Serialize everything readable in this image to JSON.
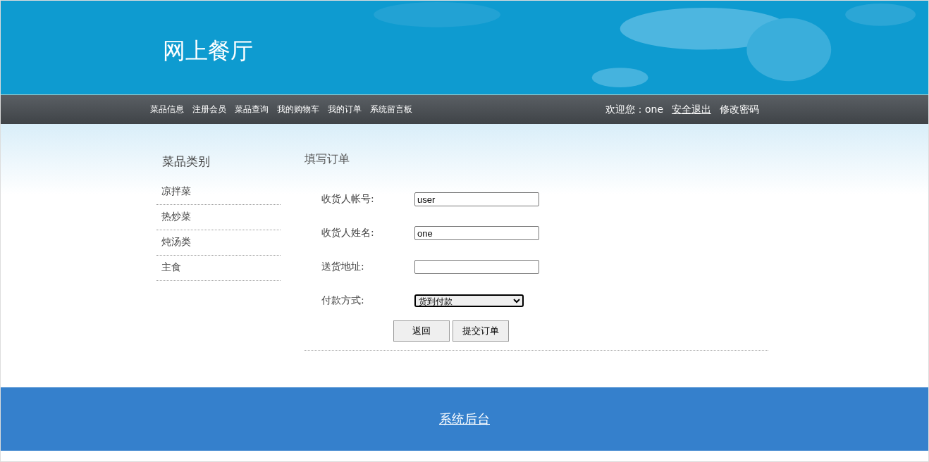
{
  "header": {
    "title": "网上餐厅"
  },
  "nav": {
    "items": [
      {
        "label": "菜品信息"
      },
      {
        "label": "注册会员"
      },
      {
        "label": "菜品查询"
      },
      {
        "label": "我的购物车"
      },
      {
        "label": "我的订单"
      },
      {
        "label": "系统留言板"
      }
    ],
    "welcome": "欢迎您：one",
    "logout": "安全退出",
    "change_password": "修改密码"
  },
  "sidebar": {
    "title": "菜品类别",
    "items": [
      {
        "label": "凉拌菜"
      },
      {
        "label": "热炒菜"
      },
      {
        "label": "炖汤类"
      },
      {
        "label": "主食"
      }
    ]
  },
  "order_form": {
    "title": "填写订单",
    "fields": [
      {
        "kind": "input",
        "label": "收货人帐号:",
        "value": "user"
      },
      {
        "kind": "input",
        "label": "收货人姓名:",
        "value": "one"
      },
      {
        "kind": "input",
        "label": "送货地址:"
      },
      {
        "kind": "select",
        "label": "付款方式:",
        "value": "货到付款"
      }
    ],
    "buttons": [
      "返回",
      "提交订单"
    ]
  },
  "footer": {
    "link": "系统后台"
  }
}
